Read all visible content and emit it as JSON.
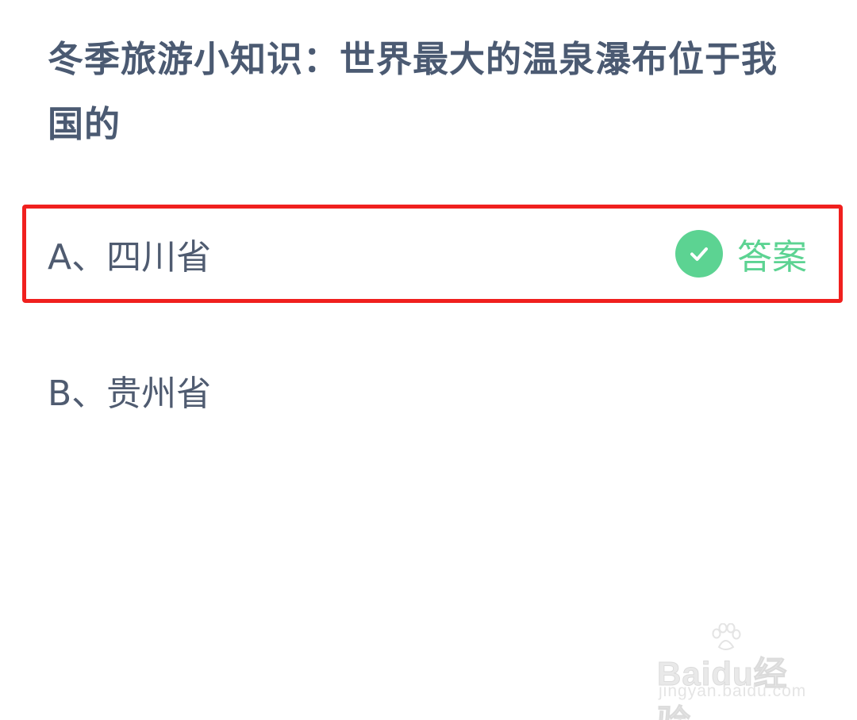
{
  "question": {
    "text": "冬季旅游小知识：世界最大的温泉瀑布位于我国的"
  },
  "options": [
    {
      "label": "A、四川省",
      "is_answer": true,
      "answer_badge": "答案"
    },
    {
      "label": "B、贵州省",
      "is_answer": false
    }
  ],
  "colors": {
    "question_text": "#4b5a72",
    "answer_green": "#5cd392",
    "highlight_red": "#f0201e"
  },
  "icons": {
    "answer_check": "check-circle-icon"
  },
  "watermark": {
    "logo": "Baidu经验",
    "url": "jingyan.baidu.com"
  }
}
